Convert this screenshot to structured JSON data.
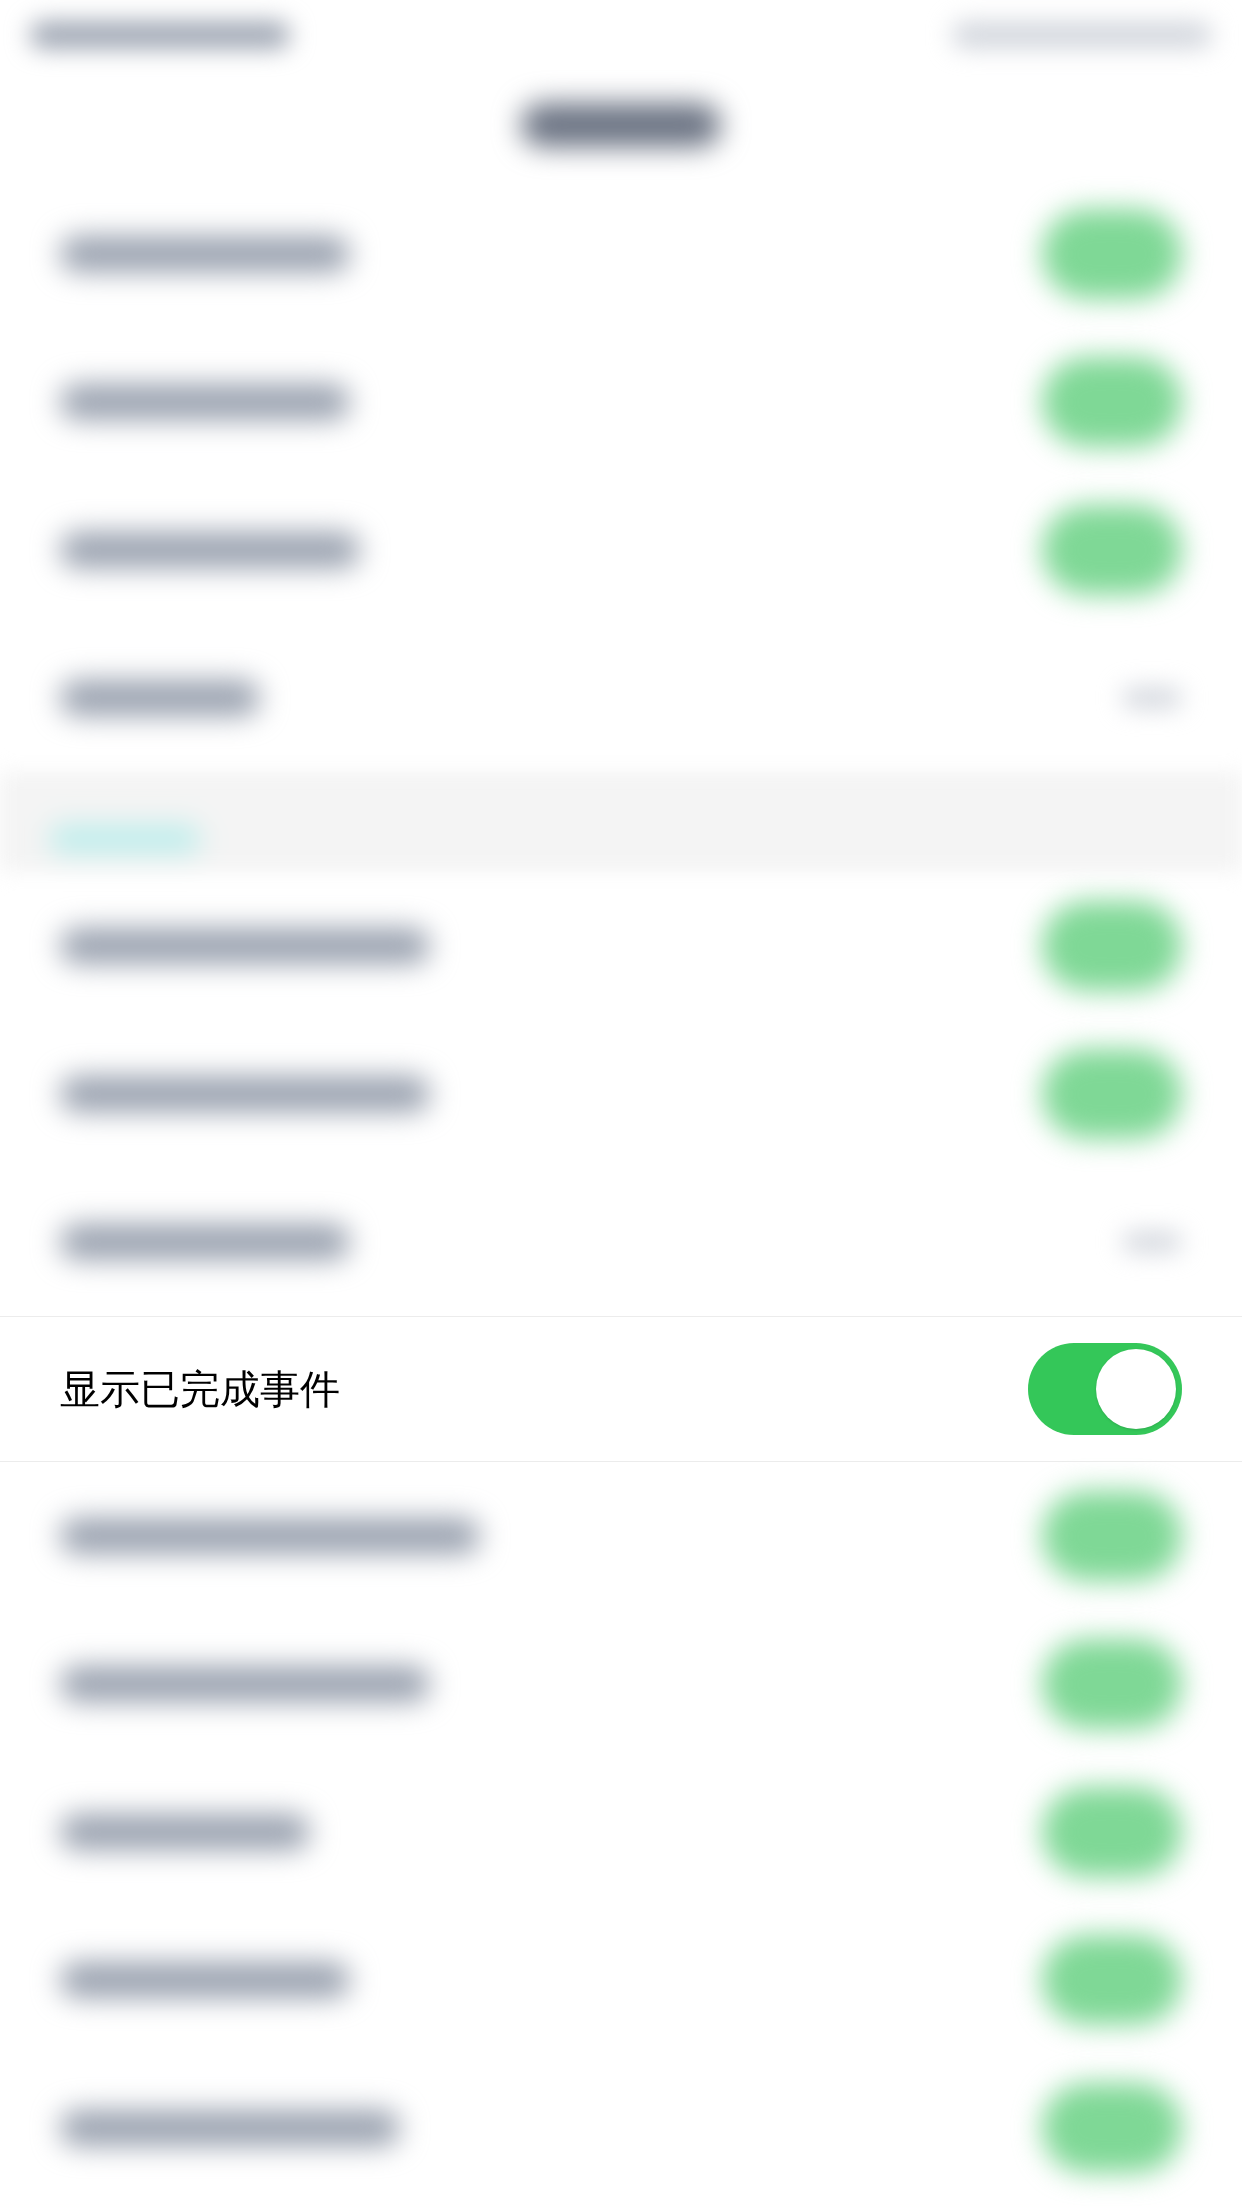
{
  "blurred_group_1": [
    {
      "kind": "toggle",
      "on": true
    },
    {
      "kind": "toggle",
      "on": true
    },
    {
      "kind": "toggle",
      "on": true
    },
    {
      "kind": "value"
    }
  ],
  "blurred_group_2": [
    {
      "kind": "toggle",
      "on": true
    },
    {
      "kind": "toggle",
      "on": true
    },
    {
      "kind": "value"
    }
  ],
  "setting": {
    "label": "显示已完成事件",
    "on": true
  },
  "blurred_group_3": [
    {
      "kind": "toggle",
      "on": true
    },
    {
      "kind": "toggle",
      "on": true
    },
    {
      "kind": "toggle",
      "on": true
    },
    {
      "kind": "toggle",
      "on": true
    },
    {
      "kind": "toggle",
      "on": true
    }
  ]
}
